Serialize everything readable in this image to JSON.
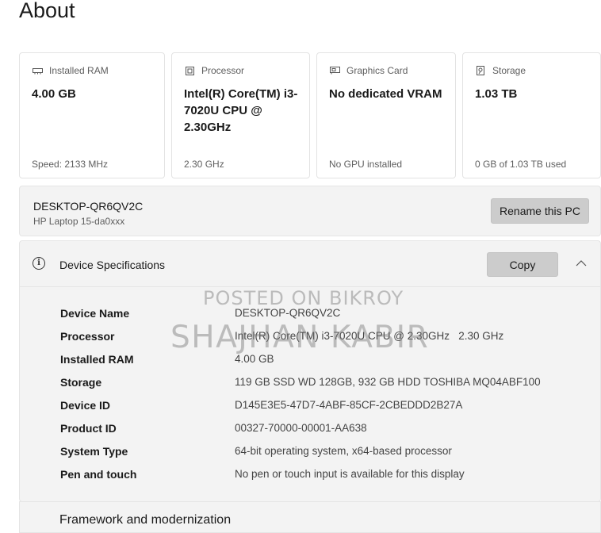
{
  "page": {
    "title": "About"
  },
  "cards": [
    {
      "label": "Installed RAM",
      "icon": "ram-icon",
      "value": "4.00 GB",
      "sub": "Speed: 2133 MHz"
    },
    {
      "label": "Processor",
      "icon": "processor-icon",
      "value": "Intel(R) Core(TM) i3-7020U CPU @ 2.30GHz",
      "sub": "2.30 GHz"
    },
    {
      "label": "Graphics Card",
      "icon": "graphics-card-icon",
      "value": "No dedicated VRAM",
      "sub": "No GPU installed"
    },
    {
      "label": "Storage",
      "icon": "storage-icon",
      "value": "1.03 TB",
      "sub": "0 GB of 1.03 TB used"
    }
  ],
  "pc": {
    "name": "DESKTOP-QR6QV2C",
    "model": "HP Laptop 15-da0xxx",
    "rename_label": "Rename this PC"
  },
  "specs": {
    "title": "Device Specifications",
    "copy_label": "Copy",
    "rows": [
      {
        "key": "Device Name",
        "value": "DESKTOP-QR6QV2C"
      },
      {
        "key": "Processor",
        "value": "Intel(R) Core(TM) i3-7020U CPU @ 2.30GHz   2.30 GHz"
      },
      {
        "key": "Installed RAM",
        "value": "4.00 GB"
      },
      {
        "key": "Storage",
        "value": "119 GB SSD WD 128GB, 932 GB HDD TOSHIBA MQ04ABF100"
      },
      {
        "key": "Device ID",
        "value": "D145E3E5-47D7-4ABF-85CF-2CBEDDD2B27A"
      },
      {
        "key": "Product ID",
        "value": "00327-70000-00001-AA638"
      },
      {
        "key": "System Type",
        "value": "64-bit operating system, x64-based processor"
      },
      {
        "key": "Pen and touch",
        "value": "No pen or touch input is available for this display"
      }
    ]
  },
  "lower_section": {
    "title": "Framework and modernization"
  },
  "watermark": {
    "line1": "POSTED ON BIKROY",
    "line2": "SHAJHAN KABIR"
  },
  "colors": {
    "panel_bg": "#f3f3f3",
    "button_bg": "#cccccc",
    "border": "#e3e3e3"
  }
}
